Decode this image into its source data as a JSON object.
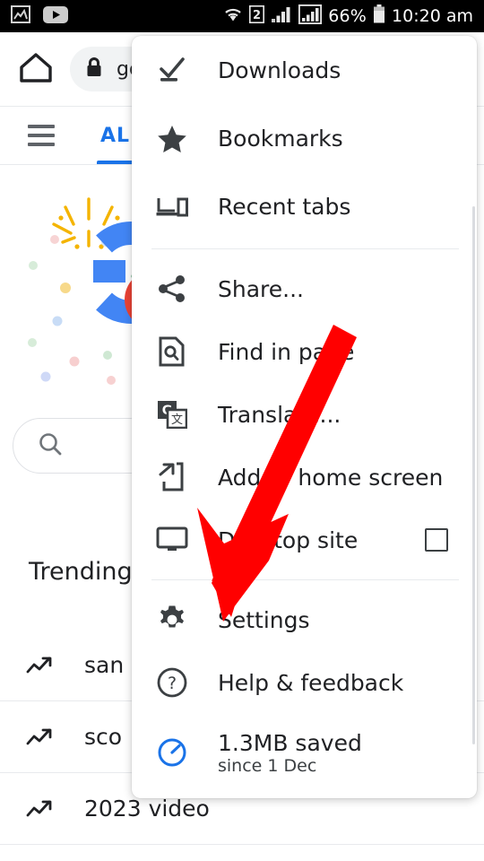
{
  "status_bar": {
    "left_icons": [
      "photo-icon",
      "youtube-icon"
    ],
    "wifi_icon": "wifi-icon",
    "sim_badge": "2",
    "signal_icons": [
      "signal-bars-icon",
      "signal-bars-boxed-icon"
    ],
    "battery_percent": "66%",
    "battery_icon": "battery-icon",
    "time": "10:20 am"
  },
  "browser_bar": {
    "home_icon": "home-icon",
    "lock_icon": "lock-icon",
    "url_text": "go"
  },
  "tab_strip": {
    "menu_icon": "hamburger-icon",
    "tabs": [
      {
        "label": "ALL",
        "active": true
      }
    ]
  },
  "page": {
    "doodle_alt": "google-doodle-logo",
    "search": {
      "icon": "search-icon",
      "placeholder": "",
      "value": ""
    },
    "trending_title": "Trending",
    "trending": [
      {
        "icon": "trending-up-icon",
        "text": "san"
      },
      {
        "icon": "trending-up-icon",
        "text": "sco"
      },
      {
        "icon": "trending-up-icon",
        "text": "2023 video"
      }
    ]
  },
  "menu": {
    "items": [
      {
        "id": "downloads",
        "icon": "download-check-icon",
        "label": "Downloads"
      },
      {
        "id": "bookmarks",
        "icon": "star-icon",
        "label": "Bookmarks"
      },
      {
        "id": "recent-tabs",
        "icon": "recent-tabs-icon",
        "label": "Recent tabs"
      },
      {
        "id": "share",
        "icon": "share-icon",
        "label": "Share..."
      },
      {
        "id": "find-in-page",
        "icon": "find-in-page-icon",
        "label": "Find in page"
      },
      {
        "id": "translate",
        "icon": "translate-icon",
        "label": "Translate..."
      },
      {
        "id": "add-to-home",
        "icon": "add-to-home-icon",
        "label": "Add to home screen"
      },
      {
        "id": "desktop-site",
        "icon": "desktop-icon",
        "label": "Desktop site",
        "checkbox": false
      },
      {
        "id": "settings",
        "icon": "gear-icon",
        "label": "Settings"
      },
      {
        "id": "help-feedback",
        "icon": "help-circle-icon",
        "label": "Help & feedback"
      },
      {
        "id": "data-saver",
        "icon": "data-saver-icon",
        "label": "1.3MB saved",
        "sublabel": "since 1 Dec"
      }
    ]
  },
  "annotation": {
    "arrow_color": "#FF0000",
    "points_to": "Settings"
  },
  "colors": {
    "accent_blue": "#1a73e8",
    "status_bar_bg": "#000000",
    "menu_bg": "#ffffff",
    "divider": "#e8eaed",
    "url_pill_bg": "#f1f3f4",
    "arrow_red": "#FF0000"
  }
}
